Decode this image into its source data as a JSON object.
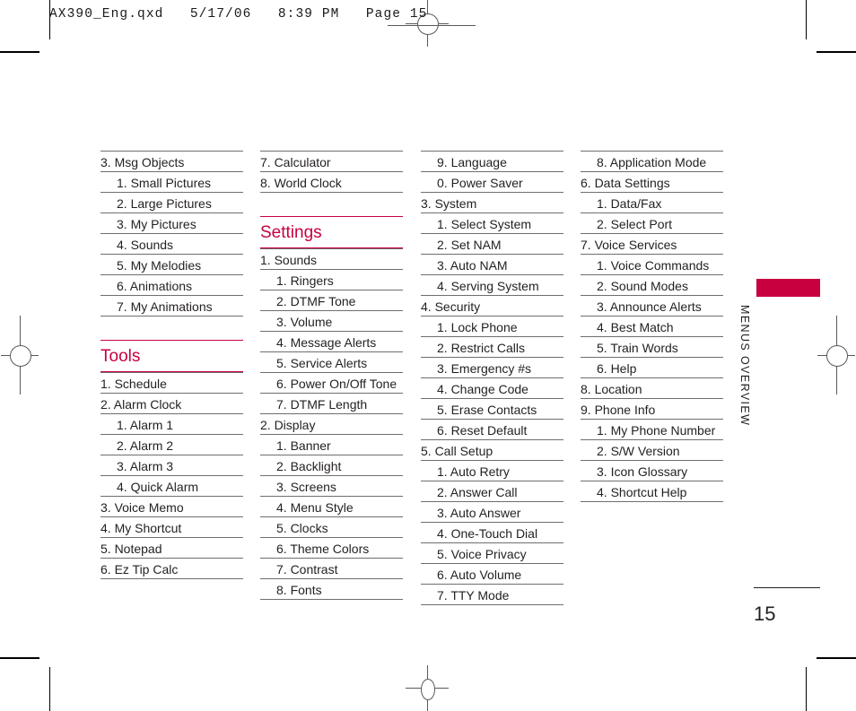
{
  "slug": {
    "text": "AX390_Eng.qxd   5/17/06   8:39 PM   Page 15"
  },
  "side": {
    "label": "MENUS OVERVIEW",
    "tab_color": "#c8003f"
  },
  "folio": {
    "page_number": "15"
  },
  "accent_color": "#c8003f",
  "rule_color": "#6d6e70",
  "columns": [
    {
      "blocks": [
        {
          "type": "list",
          "entries": [
            {
              "text": "3. Msg Objects",
              "indent": false
            },
            {
              "text": "1. Small Pictures",
              "indent": true
            },
            {
              "text": "2. Large Pictures",
              "indent": true
            },
            {
              "text": "3. My Pictures",
              "indent": true
            },
            {
              "text": "4. Sounds",
              "indent": true
            },
            {
              "text": "5. My Melodies",
              "indent": true
            },
            {
              "text": "6. Animations",
              "indent": true
            },
            {
              "text": "7. My Animations",
              "indent": true
            }
          ]
        },
        {
          "type": "heading",
          "text": "Tools"
        },
        {
          "type": "list",
          "entries": [
            {
              "text": "1. Schedule",
              "indent": false
            },
            {
              "text": "2. Alarm Clock",
              "indent": false
            },
            {
              "text": "1. Alarm 1",
              "indent": true
            },
            {
              "text": "2. Alarm 2",
              "indent": true
            },
            {
              "text": "3. Alarm 3",
              "indent": true
            },
            {
              "text": "4. Quick Alarm",
              "indent": true
            },
            {
              "text": "3. Voice Memo",
              "indent": false
            },
            {
              "text": "4. My Shortcut",
              "indent": false
            },
            {
              "text": "5. Notepad",
              "indent": false
            },
            {
              "text": "6. Ez Tip Calc",
              "indent": false
            }
          ]
        }
      ]
    },
    {
      "blocks": [
        {
          "type": "list",
          "entries": [
            {
              "text": "7. Calculator",
              "indent": false
            },
            {
              "text": "8. World Clock",
              "indent": false
            }
          ]
        },
        {
          "type": "heading",
          "text": "Settings"
        },
        {
          "type": "list",
          "entries": [
            {
              "text": "1. Sounds",
              "indent": false
            },
            {
              "text": "1. Ringers",
              "indent": true
            },
            {
              "text": "2. DTMF Tone",
              "indent": true
            },
            {
              "text": "3. Volume",
              "indent": true
            },
            {
              "text": "4. Message Alerts",
              "indent": true
            },
            {
              "text": "5. Service Alerts",
              "indent": true
            },
            {
              "text": "6. Power On/Off Tone",
              "indent": true
            },
            {
              "text": "7. DTMF Length",
              "indent": true
            },
            {
              "text": "2. Display",
              "indent": false
            },
            {
              "text": "1. Banner",
              "indent": true
            },
            {
              "text": "2. Backlight",
              "indent": true
            },
            {
              "text": "3. Screens",
              "indent": true
            },
            {
              "text": "4. Menu Style",
              "indent": true
            },
            {
              "text": "5. Clocks",
              "indent": true
            },
            {
              "text": "6. Theme Colors",
              "indent": true
            },
            {
              "text": "7. Contrast",
              "indent": true
            },
            {
              "text": "8. Fonts",
              "indent": true
            }
          ]
        }
      ]
    },
    {
      "blocks": [
        {
          "type": "list",
          "entries": [
            {
              "text": "9. Language",
              "indent": true
            },
            {
              "text": "0. Power Saver",
              "indent": true
            },
            {
              "text": "3. System",
              "indent": false
            },
            {
              "text": "1. Select System",
              "indent": true
            },
            {
              "text": "2. Set NAM",
              "indent": true
            },
            {
              "text": "3. Auto NAM",
              "indent": true
            },
            {
              "text": "4. Serving System",
              "indent": true
            },
            {
              "text": "4. Security",
              "indent": false
            },
            {
              "text": "1. Lock Phone",
              "indent": true
            },
            {
              "text": "2. Restrict Calls",
              "indent": true
            },
            {
              "text": "3. Emergency  #s",
              "indent": true
            },
            {
              "text": "4. Change Code",
              "indent": true
            },
            {
              "text": "5. Erase Contacts",
              "indent": true
            },
            {
              "text": "6. Reset Default",
              "indent": true
            },
            {
              "text": "5. Call Setup",
              "indent": false
            },
            {
              "text": "1. Auto Retry",
              "indent": true
            },
            {
              "text": "2. Answer Call",
              "indent": true
            },
            {
              "text": "3. Auto Answer",
              "indent": true
            },
            {
              "text": "4. One-Touch Dial",
              "indent": true
            },
            {
              "text": "5. Voice Privacy",
              "indent": true
            },
            {
              "text": "6. Auto Volume",
              "indent": true
            },
            {
              "text": "7. TTY Mode",
              "indent": true
            }
          ]
        }
      ]
    },
    {
      "blocks": [
        {
          "type": "list",
          "entries": [
            {
              "text": "8. Application Mode",
              "indent": true
            },
            {
              "text": "6. Data Settings",
              "indent": false
            },
            {
              "text": "1. Data/Fax",
              "indent": true
            },
            {
              "text": "2. Select Port",
              "indent": true
            },
            {
              "text": "7. Voice Services",
              "indent": false
            },
            {
              "text": "1. Voice Commands",
              "indent": true
            },
            {
              "text": "2. Sound Modes",
              "indent": true
            },
            {
              "text": "3. Announce Alerts",
              "indent": true
            },
            {
              "text": "4. Best Match",
              "indent": true
            },
            {
              "text": "5. Train Words",
              "indent": true
            },
            {
              "text": "6. Help",
              "indent": true
            },
            {
              "text": "8. Location",
              "indent": false
            },
            {
              "text": "9. Phone Info",
              "indent": false
            },
            {
              "text": "1. My Phone Number",
              "indent": true
            },
            {
              "text": "2. S/W Version",
              "indent": true
            },
            {
              "text": "3. Icon Glossary",
              "indent": true
            },
            {
              "text": "4. Shortcut Help",
              "indent": true
            }
          ]
        }
      ]
    }
  ]
}
